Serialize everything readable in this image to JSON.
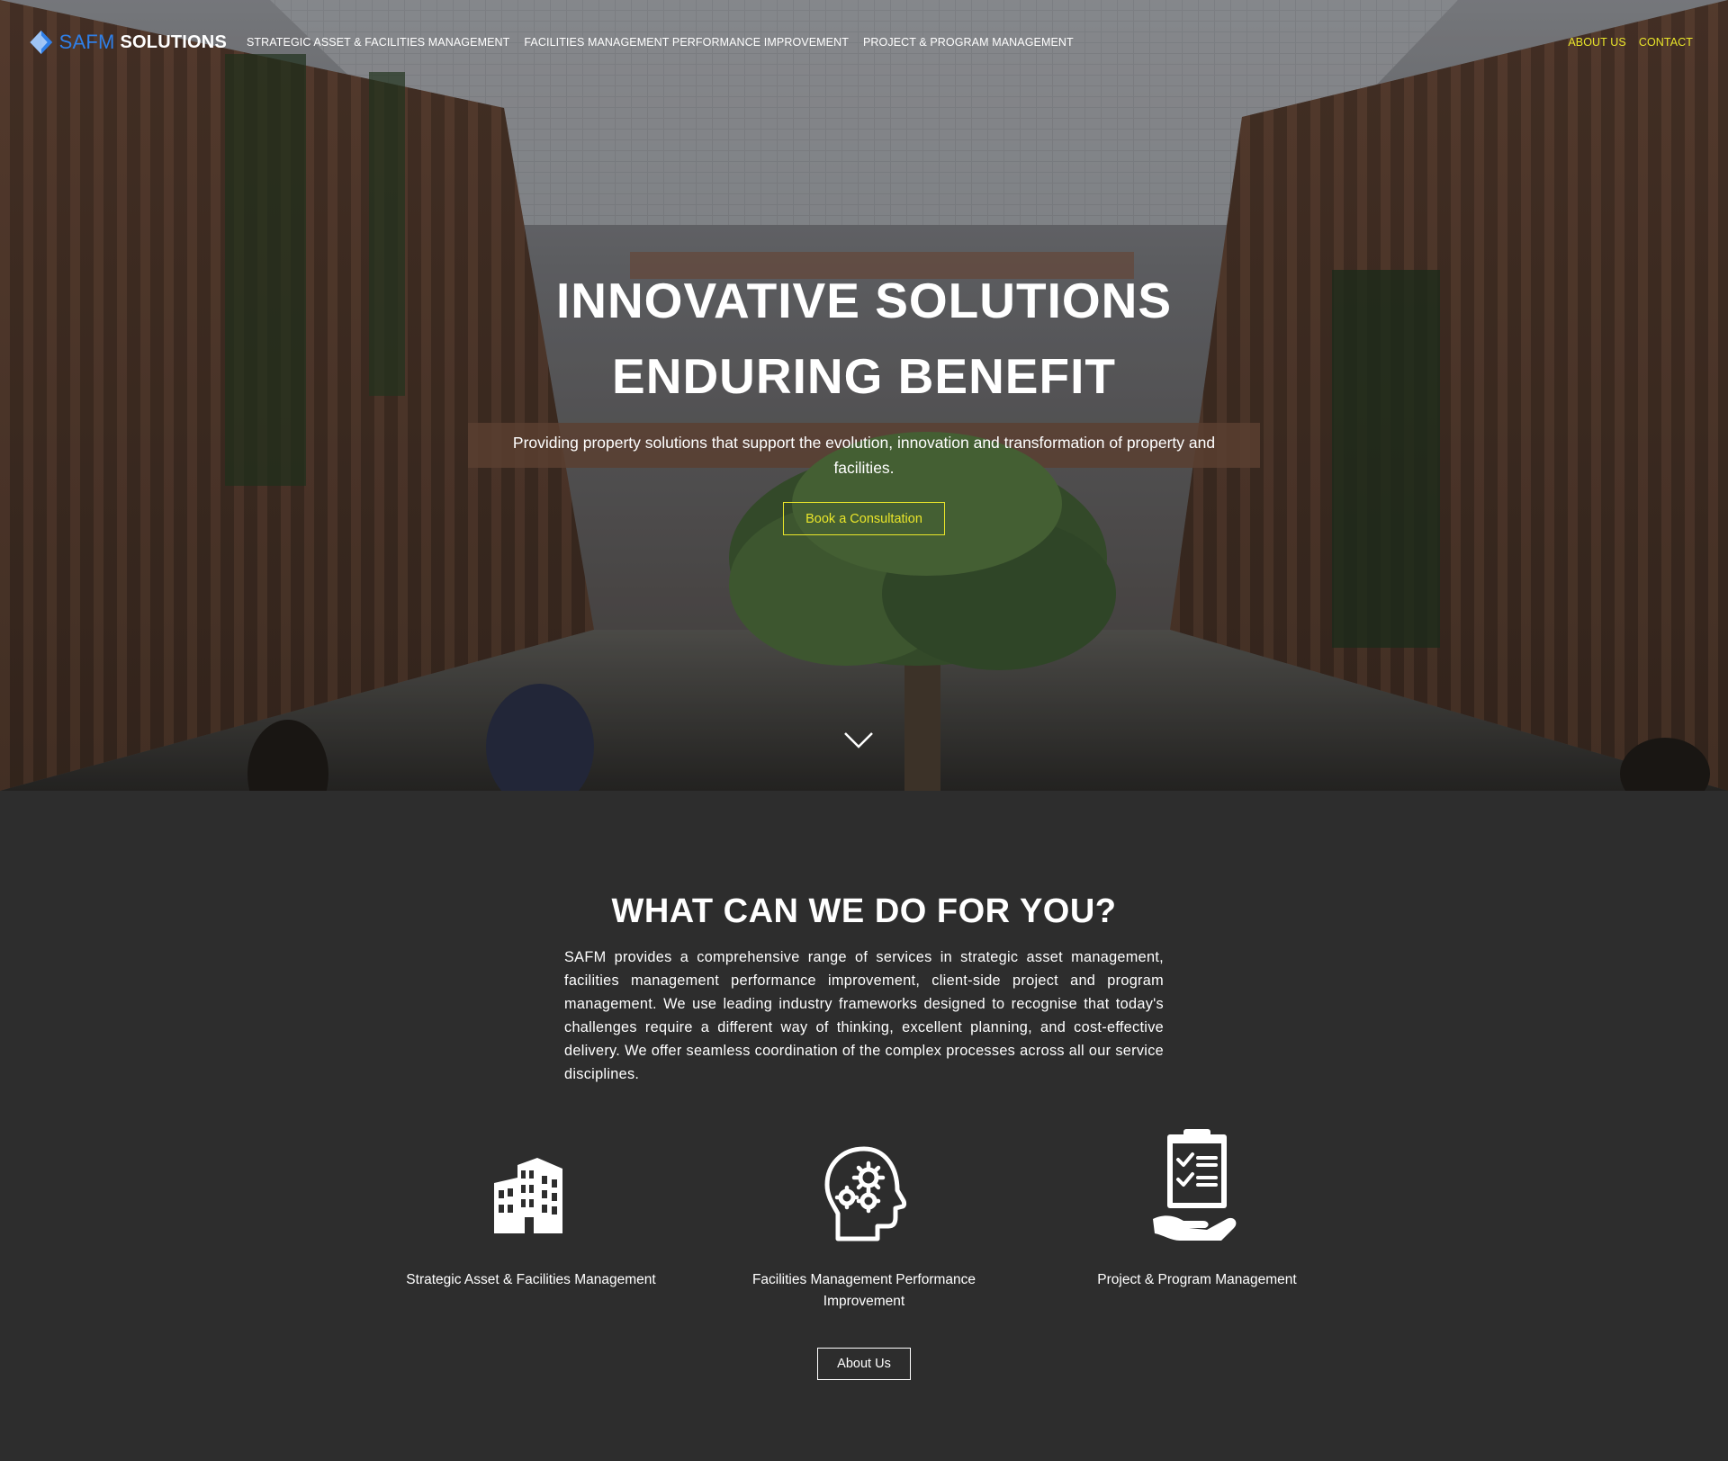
{
  "nav": {
    "logo_brand": "SAFM",
    "logo_sub": "SOLUTIONS",
    "main_links": [
      "STRATEGIC ASSET & FACILITIES MANAGEMENT",
      "FACILITIES MANAGEMENT PERFORMANCE IMPROVEMENT",
      "PROJECT & PROGRAM MANAGEMENT"
    ],
    "right_links": [
      "ABOUT US",
      "CONTACT"
    ]
  },
  "hero": {
    "title_line1": "INNOVATIVE SOLUTIONS",
    "title_line2": "ENDURING BENEFIT",
    "subtitle": "Providing property solutions that support the evolution, innovation and transformation of property and facilities.",
    "cta": "Book a Consultation",
    "scroll_icon": "chevron-down-icon"
  },
  "services": {
    "title": "WHAT CAN WE DO FOR YOU?",
    "description": "SAFM provides a comprehensive range of services in strategic asset management, facilities management performance improvement, client-side project and program management. We use leading industry frameworks designed to recognise that today's challenges require a different way of thinking, excellent planning, and cost-effective delivery. We offer seamless coordination of the complex processes across all our service disciplines.",
    "items": [
      {
        "label": "Strategic Asset & Facilities Management",
        "icon": "building-icon"
      },
      {
        "label": "Facilities Management Performance Improvement",
        "icon": "head-gears-icon"
      },
      {
        "label": "Project & Program Management",
        "icon": "clipboard-hand-icon"
      }
    ],
    "about_button": "About Us"
  },
  "colors": {
    "accent_yellow": "#e9e52a",
    "brand_blue": "#2f7fe8",
    "section_bg": "#2d2d2d"
  }
}
